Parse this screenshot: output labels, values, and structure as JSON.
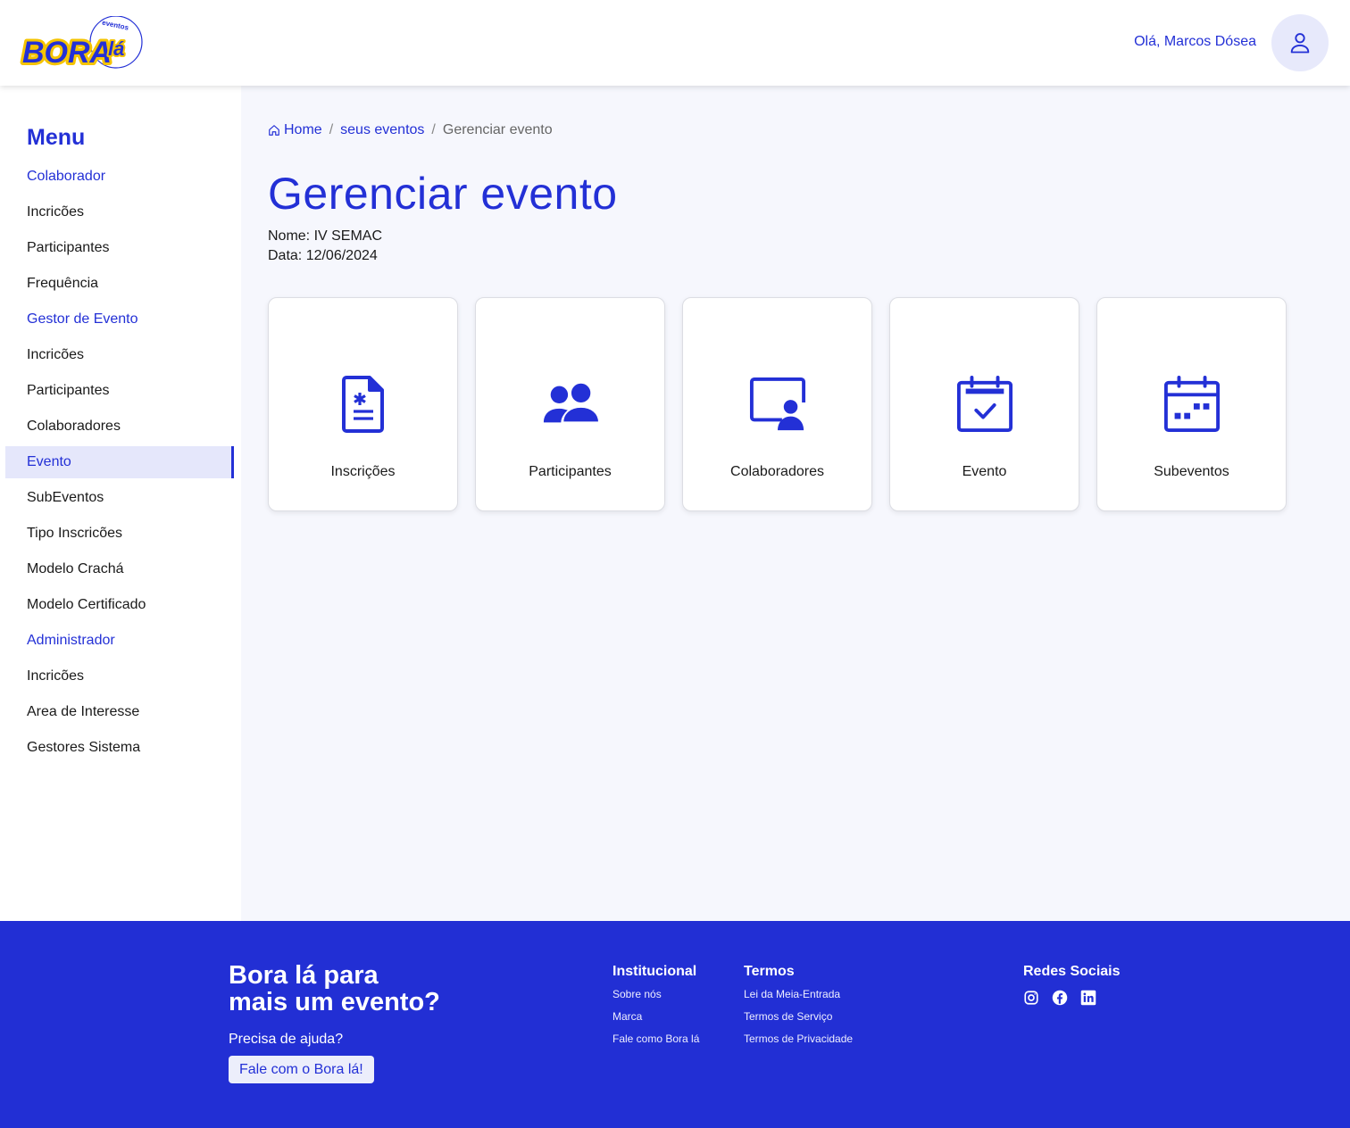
{
  "header": {
    "logo_text": "BORA lá",
    "logo_sub": "eventos",
    "greeting": "Olá, Marcos Dósea"
  },
  "sidebar": {
    "title": "Menu",
    "items": [
      {
        "label": "Colaborador",
        "kind": "section"
      },
      {
        "label": "Incricões",
        "kind": "item"
      },
      {
        "label": "Participantes",
        "kind": "item"
      },
      {
        "label": "Frequência",
        "kind": "item"
      },
      {
        "label": "Gestor de Evento",
        "kind": "section"
      },
      {
        "label": "Incricões",
        "kind": "item"
      },
      {
        "label": "Participantes",
        "kind": "item"
      },
      {
        "label": "Colaboradores",
        "kind": "item"
      },
      {
        "label": "Evento",
        "kind": "active"
      },
      {
        "label": "SubEventos",
        "kind": "item"
      },
      {
        "label": "Tipo Inscricões",
        "kind": "item"
      },
      {
        "label": "Modelo Crachá",
        "kind": "item"
      },
      {
        "label": "Modelo Certificado",
        "kind": "item"
      },
      {
        "label": "Administrador",
        "kind": "section"
      },
      {
        "label": "Incricões",
        "kind": "item"
      },
      {
        "label": "Area de Interesse",
        "kind": "item"
      },
      {
        "label": "Gestores Sistema",
        "kind": "item"
      }
    ]
  },
  "breadcrumb": {
    "home": "Home",
    "events": "seus eventos",
    "current": "Gerenciar evento",
    "separator": "/"
  },
  "page": {
    "title": "Gerenciar evento",
    "name_line": "Nome: IV SEMAC",
    "date_line": "Data: 12/06/2024"
  },
  "cards": [
    {
      "label": "Inscrições",
      "icon": "document-asterisk-icon"
    },
    {
      "label": "Participantes",
      "icon": "users-icon"
    },
    {
      "label": "Colaboradores",
      "icon": "presentation-user-icon"
    },
    {
      "label": "Evento",
      "icon": "calendar-check-icon"
    },
    {
      "label": "Subeventos",
      "icon": "calendar-dots-icon"
    }
  ],
  "footer": {
    "tagline_1": "Bora lá para",
    "tagline_2": "mais um evento?",
    "help": "Precisa de ajuda?",
    "contact_button": "Fale com o Bora lá!",
    "institucional": {
      "title": "Institucional",
      "links": [
        "Sobre nós",
        "Marca",
        "Fale como Bora lá"
      ]
    },
    "termos": {
      "title": "Termos",
      "links": [
        "Lei da Meia-Entrada",
        "Termos de Serviço",
        "Termos de Privacidade"
      ]
    },
    "social": {
      "title": "Redes Sociais",
      "icons": [
        "instagram-icon",
        "facebook-icon",
        "linkedin-icon"
      ]
    }
  },
  "colors": {
    "primary": "#2330d6",
    "logo_yellow": "#f5c400",
    "main_bg": "#f6f7fd",
    "active_bg": "#e5e7fb"
  }
}
